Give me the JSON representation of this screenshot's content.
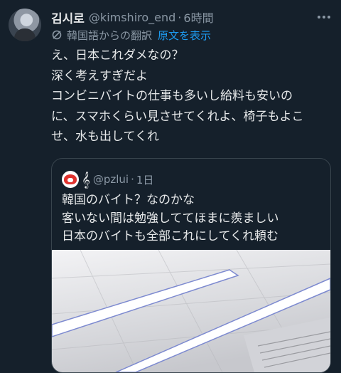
{
  "tweet": {
    "display_name": "김시로",
    "handle": "@kimshiro_end",
    "separator": "·",
    "time": "6時間",
    "translation_label": "韓国語からの翻訳",
    "show_original": "原文を表示",
    "lines": [
      "え、日本これダメなの？",
      "深く考えすぎだよ",
      "コンビニバイトの仕事も多いし給料も安いの",
      "に、スマホくらい見させてくれよ、椅子もよこ",
      "せ、水も出してくれ"
    ]
  },
  "quote": {
    "badge": "𝄞",
    "handle": "@pzlui",
    "separator": "·",
    "time": "1日",
    "lines": [
      "韓国のバイト？なのかな",
      "客いない間は勉強しててほまに羨ましい",
      "日本のバイトも全部これにしてくれ頼む"
    ]
  },
  "icons": {
    "more": "more-dots-icon",
    "translate": "translate-icon"
  },
  "colors": {
    "background": "#15202b",
    "text": "#e7e9ea",
    "secondary": "#8b98a5",
    "link": "#1d9bf0",
    "border": "#38444d"
  }
}
